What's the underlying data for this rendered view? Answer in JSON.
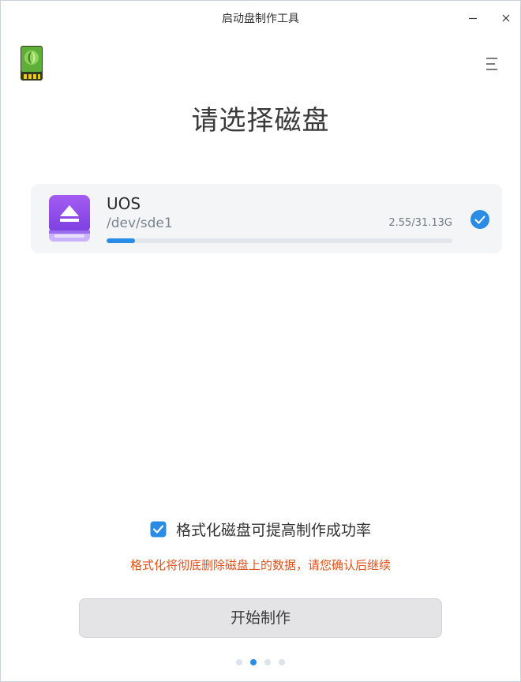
{
  "window": {
    "title": "启动盘制作工具"
  },
  "page": {
    "title": "请选择磁盘"
  },
  "disk": {
    "name": "UOS",
    "path": "/dev/sde1",
    "size": "2.55/31.13G",
    "used_fraction": 0.082,
    "selected": true
  },
  "format": {
    "checked": true,
    "label": "格式化磁盘可提高制作成功率",
    "warning": "格式化将彻底删除磁盘上的数据，请您确认后继续"
  },
  "actions": {
    "start_label": "开始制作"
  },
  "pager": {
    "count": 4,
    "active_index": 1
  },
  "colors": {
    "accent": "#2b8ce6",
    "warning": "#e0521b",
    "disk_icon": "#8b4fe8"
  },
  "icons": {
    "app": "usb-drive-icon",
    "menu": "menu-icon",
    "minimize": "minimize-icon",
    "close": "close-icon",
    "disk": "removable-disk-icon",
    "selected": "check-circle-icon",
    "checkbox": "checkbox-checked-icon"
  }
}
